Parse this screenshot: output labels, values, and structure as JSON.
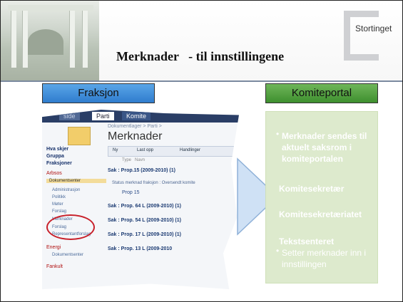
{
  "header": {
    "logo_text": "Stortinget",
    "title": "Merknader   - til innstillingene"
  },
  "buttons": {
    "fraksjon": "Fraksjon",
    "komiteportal": "Komiteportal"
  },
  "colors": {
    "blue": "#3d8bd8",
    "green": "#4fa03b",
    "panel": "#ddeacd",
    "accent_red": "#c8202a"
  },
  "screenshot": {
    "tabs": [
      "side",
      "Parti",
      "Komite"
    ],
    "breadcrumb": "Dokumentlager > Parti >",
    "page_title": "Merknader",
    "toolbar": [
      "Ny",
      "Last opp",
      "Handlinger"
    ],
    "columns": [
      "Type",
      "Navn"
    ],
    "nav": {
      "headings": [
        "Hva skjer",
        "Gruppa",
        "Fraksjoner"
      ],
      "arbsos": "Arbsos",
      "active": "Dokumentsenter",
      "items": [
        "Administrasjon",
        "Politikk",
        "Møter",
        "Forslag",
        "Merknader",
        "Forslag",
        "Representantforslag"
      ],
      "energi": "Energi",
      "energi_items": [
        "Dokumentsenter"
      ],
      "fankult": "Fankult"
    },
    "rows": {
      "r1": "Sak : Prop.15 (2009-2010) (1)",
      "r1_status": "Status merknad fraksjon : Oversendt komite",
      "r1_doc": "Prop 15",
      "r2": "Sak : Prop. 64 L (2009-2010) (1)",
      "r3": "Sak : Prop. 54 L (2009-2010) (1)",
      "r4": "Sak : Prop. 17 L (2009-2010) (1)",
      "r5": "Sak : Prop. 13 L (2009-2010"
    }
  },
  "right_panel": {
    "bullet1": "Merknader sendes til aktuelt saksrom i komiteportalen",
    "line1": "Komitesekretær",
    "line2": "Komitesekretæriatet",
    "line3": "Tekstsenteret",
    "bullet2": "Setter merknader inn i innstillingen"
  }
}
